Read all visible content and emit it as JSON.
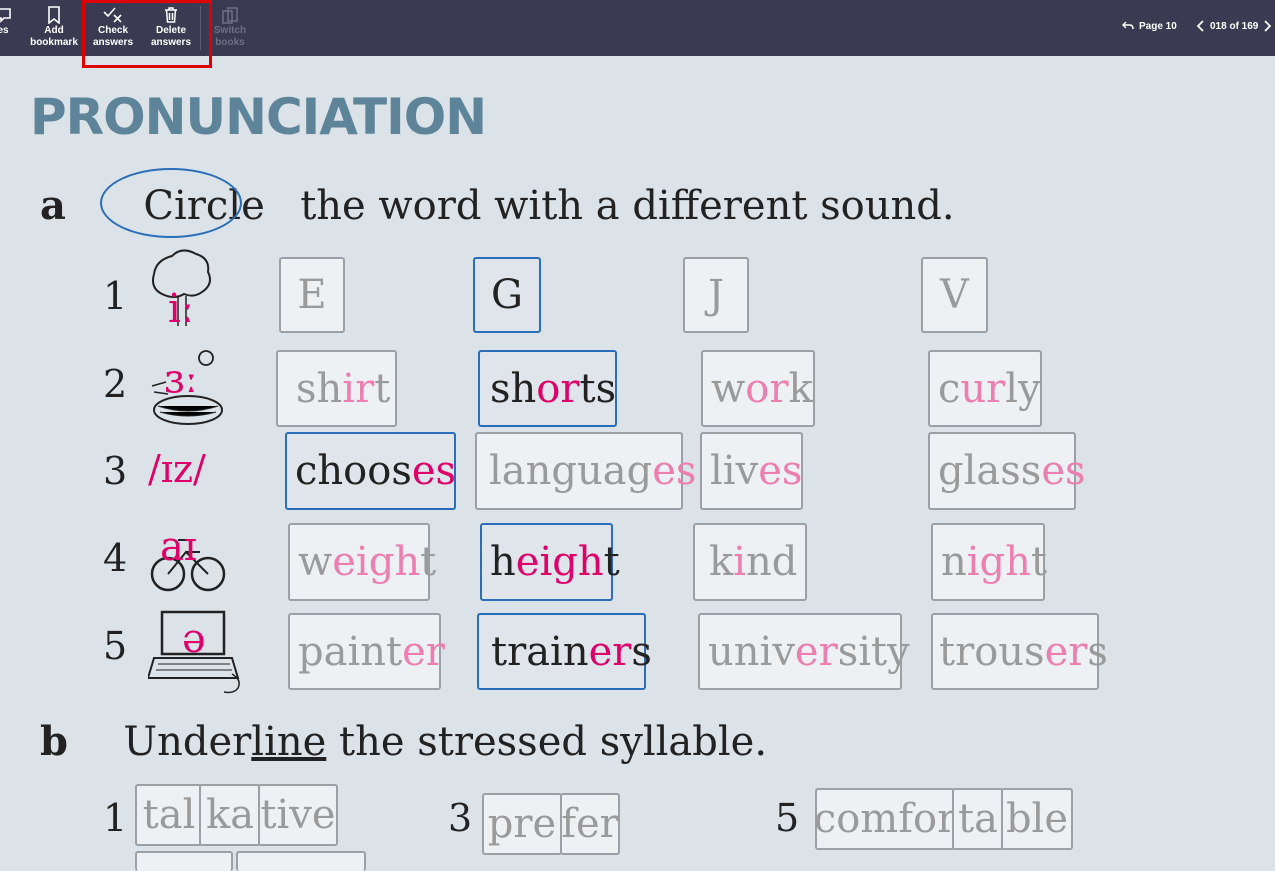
{
  "toolbar": {
    "notes_label": "es",
    "bookmark_line1": "Add",
    "bookmark_line2": "bookmark",
    "check_line1": "Check",
    "check_line2": "answers",
    "delete_line1": "Delete",
    "delete_line2": "answers",
    "switch_line1": "Switch",
    "switch_line2": "books",
    "page_label": "Page 10",
    "page_counter": "018 of 169"
  },
  "heading": "PRONUNCIATION",
  "section_a": {
    "letter": "a",
    "circle_word": "Circle",
    "instruction": "the word with a different sound.",
    "rows": [
      {
        "num": "1",
        "symbol": "iː",
        "words": [
          {
            "text": "E",
            "selected": false
          },
          {
            "text": "G",
            "selected": true
          },
          {
            "text": "J",
            "selected": false
          },
          {
            "text": "V",
            "selected": false
          }
        ]
      },
      {
        "num": "2",
        "symbol": "ɜː",
        "words": [
          {
            "pre": "sh",
            "hl": "ir",
            "post": "t",
            "selected": false
          },
          {
            "pre": "sh",
            "hl": "or",
            "post": "ts",
            "selected": true
          },
          {
            "pre": "w",
            "hl": "or",
            "post": "k",
            "selected": false
          },
          {
            "pre": "c",
            "hl": "ur",
            "post": "ly",
            "selected": false
          }
        ]
      },
      {
        "num": "3",
        "symbol": "/ɪz/",
        "words": [
          {
            "pre": "choos",
            "hl": "es",
            "post": "",
            "selected": true
          },
          {
            "pre": "languag",
            "hl": "es",
            "post": "",
            "selected": false
          },
          {
            "pre": "liv",
            "hl": "es",
            "post": "",
            "selected": false
          },
          {
            "pre": "glass",
            "hl": "es",
            "post": "",
            "selected": false
          }
        ]
      },
      {
        "num": "4",
        "symbol": "aɪ",
        "words": [
          {
            "pre": "w",
            "hl": "eigh",
            "post": "t",
            "selected": false
          },
          {
            "pre": "h",
            "hl": "eigh",
            "post": "t",
            "selected": true
          },
          {
            "pre": "k",
            "hl": "i",
            "post": "nd",
            "selected": false
          },
          {
            "pre": "n",
            "hl": "igh",
            "post": "t",
            "selected": false
          }
        ]
      },
      {
        "num": "5",
        "symbol": "ə",
        "words": [
          {
            "pre": "paint",
            "hl": "er",
            "post": "",
            "selected": false
          },
          {
            "pre": "train",
            "hl": "er",
            "post": "s",
            "selected": true
          },
          {
            "pre": "univ",
            "hl": "er",
            "post": "sity",
            "selected": false
          },
          {
            "pre": "trous",
            "hl": "er",
            "post": "s",
            "selected": false
          }
        ]
      }
    ]
  },
  "section_b": {
    "letter": "b",
    "pre": "Under",
    "underlined": "line",
    "post": " the stressed syllable.",
    "items": [
      {
        "num": "1",
        "syllables": [
          "tal",
          "ka",
          "tive"
        ]
      },
      {
        "num": "3",
        "syllables": [
          "pre",
          "fer"
        ]
      },
      {
        "num": "5",
        "syllables": [
          "comfor",
          "ta",
          "ble"
        ]
      }
    ]
  },
  "colors": {
    "toolbar_bg": "#3a3a52",
    "heading": "#5e8499",
    "accent_pink": "#e0006a",
    "selection_blue": "#2a6db8",
    "highlight_red": "#e00000"
  }
}
